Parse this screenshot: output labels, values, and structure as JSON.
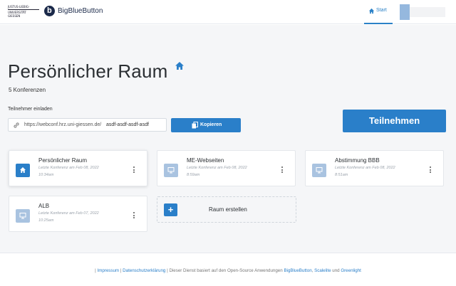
{
  "header": {
    "uni_logo_line1": "JUSTUS-LIEBIG-",
    "uni_logo_line2": "UNIVERSITÄT GIESSEN",
    "brand": "BigBlueButton",
    "nav_start": "Start",
    "home_icon": "home-icon"
  },
  "room": {
    "title": "Persönlicher Raum",
    "subtitle": "5 Konferenzen",
    "invite_label": "Teilnehmer einladen",
    "invite_url": "https://webconf.hrz.uni-giessen.de/",
    "invite_suffix": "asdf-asdf-asdf-asdf",
    "copy_label": "Kopieren",
    "join_label": "Teilnehmen"
  },
  "cards": [
    {
      "name": "Persönlicher Raum",
      "meta": "Letzte Konferenz am Feb 08, 2022",
      "time": "10:34am",
      "icon": "home-icon",
      "active": true
    },
    {
      "name": "ME-Webseiten",
      "meta": "Letzte Konferenz am Feb 08, 2022",
      "time": "8:59am",
      "icon": "presentation-icon",
      "active": false
    },
    {
      "name": "Abstimmung BBB",
      "meta": "Letzte Konferenz am Feb 08, 2022",
      "time": "8:51am",
      "icon": "presentation-icon",
      "active": false
    },
    {
      "name": "ALB",
      "meta": "Letzte Konferenz am Feb 07, 2022",
      "time": "10:25am",
      "icon": "presentation-icon",
      "active": false
    }
  ],
  "create_room": {
    "label": "Raum erstellen",
    "icon": "plus-icon"
  },
  "footer": {
    "sep": "|",
    "impressum": "Impressum",
    "datenschutz": "Datenschutzerklärung",
    "text": "Dieser Dienst basiert auf den Open-Source Anwendungen",
    "bbb": "BigBlueButton",
    "comma": ",",
    "scalelite": "Scalelite",
    "und": "und",
    "greenlight": "Greenlight"
  },
  "colors": {
    "accent": "#2a7fc9",
    "background": "#f5f6f8",
    "icon_inactive": "#a9c3e0"
  }
}
